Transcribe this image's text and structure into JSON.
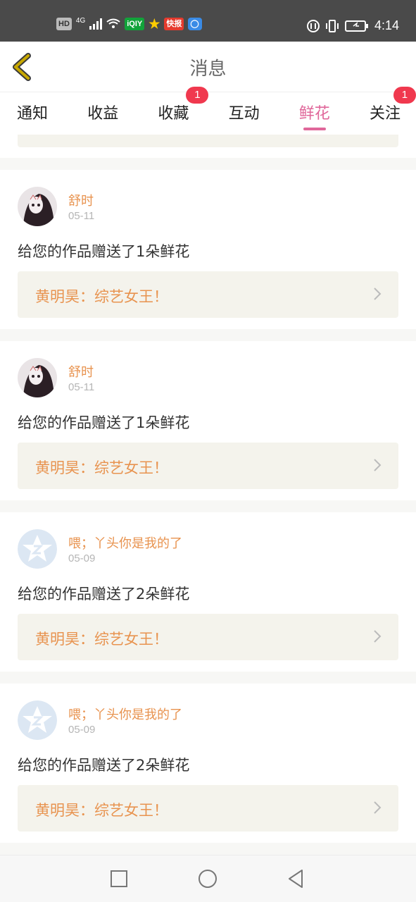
{
  "status_bar": {
    "left_labels": [
      "HD",
      "4G"
    ],
    "app_icons": [
      "iqiyi-icon",
      "star-icon",
      "kuaibao-icon",
      "browser-icon"
    ],
    "app_labels": {
      "iqiyi": "iQIY",
      "kuaibao": "快报"
    },
    "time": "4:14"
  },
  "header": {
    "title": "消息"
  },
  "tabs": [
    {
      "label": "通知",
      "badge": ""
    },
    {
      "label": "收益",
      "badge": ""
    },
    {
      "label": "收藏",
      "badge": "1"
    },
    {
      "label": "互动",
      "badge": ""
    },
    {
      "label": "鲜花",
      "badge": "",
      "active": true
    },
    {
      "label": "关注",
      "badge": "1"
    }
  ],
  "messages": [
    {
      "user": "舒时",
      "date": "05-11",
      "text": "给您的作品赠送了1朵鲜花",
      "work": "黄明昊：综艺女王！",
      "avatar": "photo"
    },
    {
      "user": "舒时",
      "date": "05-11",
      "text": "给您的作品赠送了1朵鲜花",
      "work": "黄明昊：综艺女王！",
      "avatar": "photo"
    },
    {
      "user": "喂；丫头你是我的了",
      "date": "05-09",
      "text": "给您的作品赠送了2朵鲜花",
      "work": "黄明昊：综艺女王！",
      "avatar": "default"
    },
    {
      "user": "喂；丫头你是我的了",
      "date": "05-09",
      "text": "给您的作品赠送了2朵鲜花",
      "work": "黄明昊：综艺女王！",
      "avatar": "default"
    }
  ],
  "colors": {
    "accent_pink": "#e0679a",
    "orange_text": "#e8934f",
    "badge_red": "#f0384e",
    "back_arrow": "#c8a800"
  }
}
